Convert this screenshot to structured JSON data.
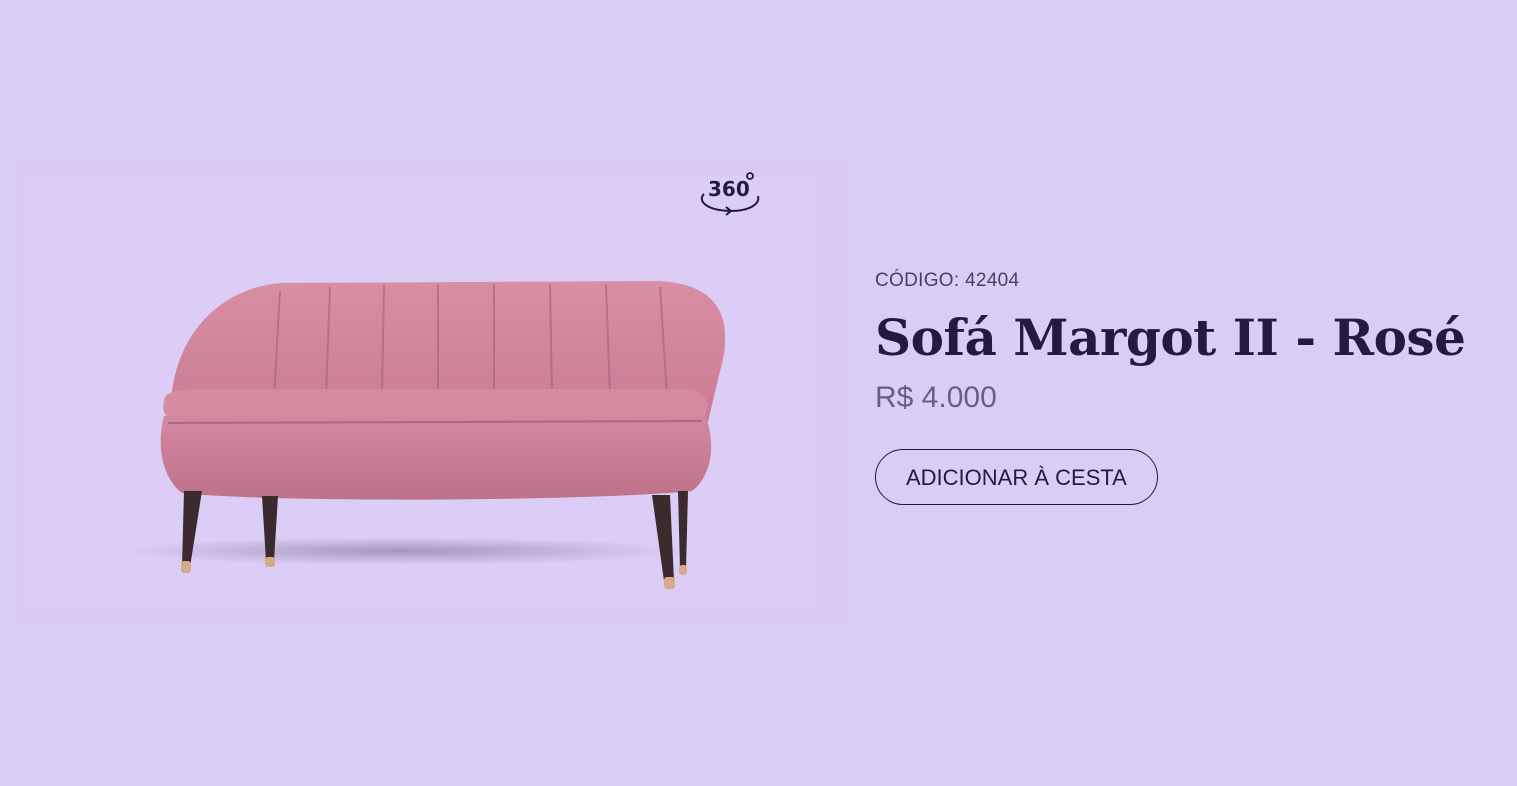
{
  "product": {
    "code_label": "CÓDIGO: 42404",
    "name": "Sofá Margot II - Rosé",
    "price": "R$ 4.000",
    "add_to_cart_label": "ADICIONAR À CESTA",
    "image_alt": "Sofá Margot II - Rosé",
    "rotate_icon": "360-rotate-icon"
  },
  "colors": {
    "background": "#d9cdf4",
    "text_dark": "#241a3f",
    "price_text": "#6a5c88",
    "sofa_pink": "#d9889f"
  }
}
